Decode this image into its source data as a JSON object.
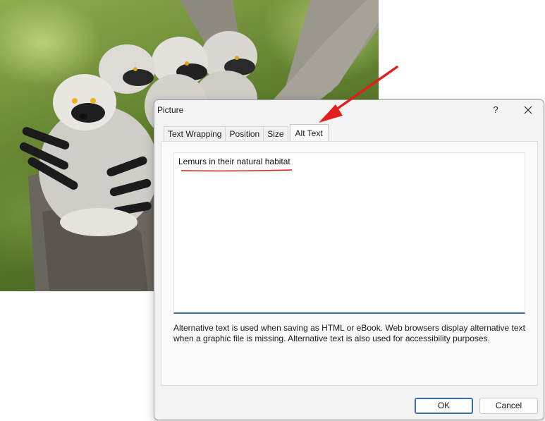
{
  "dialog": {
    "title": "Picture",
    "help_label": "?",
    "tabs": [
      {
        "label": "Text Wrapping"
      },
      {
        "label": "Position"
      },
      {
        "label": "Size"
      },
      {
        "label": "Alt Text",
        "active": true
      }
    ],
    "alt_text_value": "Lemurs in their natural habitat",
    "description": "Alternative text is used when saving as HTML or eBook. Web browsers display alternative text when a graphic file is missing. Alternative text is also used for accessibility purposes.",
    "ok_label": "OK",
    "cancel_label": "Cancel"
  },
  "icons": {
    "help": "question-icon",
    "close": "close-icon",
    "annotation": "red-arrow-icon"
  },
  "colors": {
    "accent": "#3a6ea5",
    "annotation": "#e21d1d",
    "dialog_bg": "#f3f3f3"
  }
}
